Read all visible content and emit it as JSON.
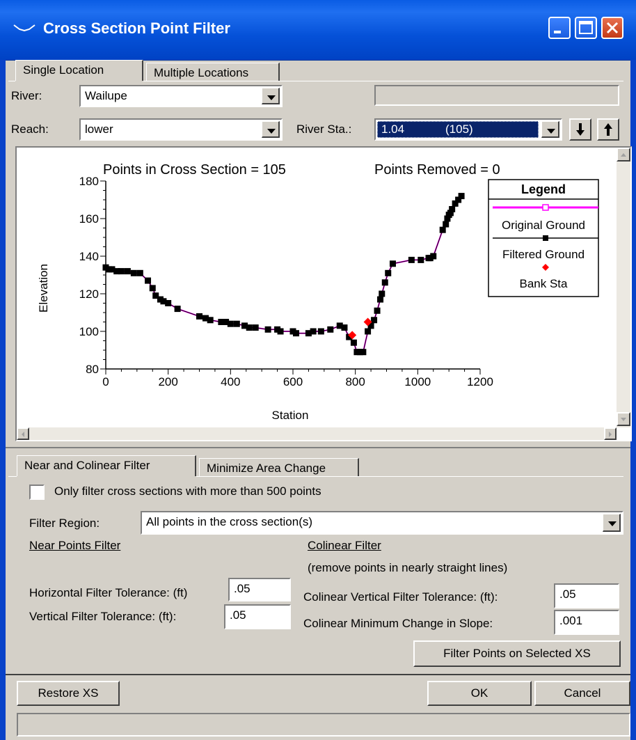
{
  "window": {
    "title": "Cross Section Point Filter"
  },
  "top_tabs": [
    {
      "label": "Single Location",
      "active": true
    },
    {
      "label": "Multiple Locations",
      "active": false
    }
  ],
  "river": {
    "label": "River:",
    "value": "Wailupe"
  },
  "reach": {
    "label": "Reach:",
    "value": "lower"
  },
  "river_sta": {
    "label": "River Sta.:",
    "value": "1.04",
    "points": "(105)"
  },
  "nav_icons": [
    "arrow-down-icon",
    "arrow-up-icon"
  ],
  "chart_data": {
    "type": "line",
    "title": "Points in Cross Section = 105",
    "subtitle": "Points Removed = 0",
    "xlabel": "Station",
    "ylabel": "Elevation",
    "xlim": [
      0,
      1200
    ],
    "ylim": [
      80,
      180
    ],
    "xticks": [
      "0",
      "200",
      "400",
      "600",
      "800",
      "1000",
      "1200"
    ],
    "yticks": [
      "80",
      "100",
      "120",
      "140",
      "160",
      "180"
    ],
    "legend": {
      "title": "Legend",
      "placement": "top-right",
      "entries": [
        "Original Ground",
        "Filtered Ground",
        "Bank Sta"
      ]
    },
    "colors": {
      "original": "#ff00ff",
      "filtered": "#000000",
      "bank": "#ff0000"
    },
    "series": [
      {
        "name": "Filtered Ground",
        "x": [
          0,
          10,
          20,
          35,
          50,
          70,
          90,
          110,
          135,
          150,
          160,
          175,
          185,
          200,
          230,
          300,
          320,
          335,
          370,
          385,
          400,
          420,
          445,
          460,
          480,
          520,
          550,
          560,
          600,
          610,
          650,
          665,
          690,
          720,
          750,
          765,
          780,
          795,
          805,
          815,
          825,
          840,
          850,
          860,
          870,
          880,
          885,
          895,
          905,
          920,
          980,
          1010,
          1035,
          1040,
          1050,
          1080,
          1090,
          1095,
          1100,
          1105,
          1110,
          1120,
          1130,
          1140
        ],
        "y": [
          134,
          133,
          133,
          132,
          132,
          132,
          131,
          131,
          127,
          123,
          119,
          117,
          116,
          115,
          112,
          108,
          107,
          106,
          105,
          105,
          104,
          104,
          103,
          102,
          102,
          101,
          101,
          100,
          100,
          99,
          99,
          100,
          100,
          101,
          103,
          102,
          97,
          94,
          89,
          89,
          89,
          100,
          103,
          106,
          111,
          117,
          120,
          126,
          131,
          136,
          138,
          138,
          139,
          139,
          140,
          154,
          157,
          160,
          162,
          163,
          165,
          168,
          170,
          172
        ]
      }
    ],
    "bank_stations": [
      {
        "x": 790,
        "y": 98
      },
      {
        "x": 840,
        "y": 105
      }
    ]
  },
  "bottom_tabs": [
    {
      "label": "Near and Colinear Filter",
      "active": true
    },
    {
      "label": "Minimize Area Change",
      "active": false
    }
  ],
  "only_filter": {
    "label": "Only filter cross sections with more than 500 points",
    "checked": false
  },
  "filter_region": {
    "label": "Filter Region:",
    "value": "All points in the cross section(s)"
  },
  "near_points": {
    "heading": "Near Points Filter",
    "horizontal_label": "Horizontal Filter Tolerance: (ft)",
    "horizontal_value": ".05",
    "vertical_label": "Vertical Filter Tolerance: (ft):",
    "vertical_value": ".05"
  },
  "colinear": {
    "heading": "Colinear Filter",
    "note": "(remove points in nearly straight lines)",
    "vertical_label": "Colinear Vertical Filter Tolerance: (ft):",
    "vertical_value": ".05",
    "slope_label": "Colinear Minimum Change in Slope:",
    "slope_value": ".001"
  },
  "buttons": {
    "filter": "Filter Points on Selected XS",
    "restore": "Restore XS",
    "ok": "OK",
    "cancel": "Cancel"
  }
}
